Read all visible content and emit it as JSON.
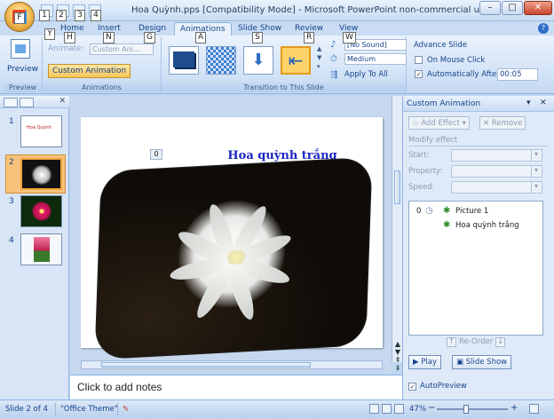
{
  "window": {
    "title": "Hoa Quỳnh.pps [Compatibility Mode] - Microsoft PowerPoint non-commercial use",
    "minimize_glyph": "–",
    "maximize_glyph": "□",
    "close_glyph": "✕"
  },
  "keytips": {
    "office": "F",
    "qat": [
      "1",
      "2",
      "3",
      "4"
    ],
    "ribbon_help": "Y",
    "tabs": [
      "H",
      "N",
      "G",
      "A",
      "S",
      "R",
      "W"
    ]
  },
  "tabs": [
    {
      "label": "Home"
    },
    {
      "label": "Insert"
    },
    {
      "label": "Design"
    },
    {
      "label": "Animations",
      "active": true
    },
    {
      "label": "Slide Show"
    },
    {
      "label": "Review"
    },
    {
      "label": "View"
    }
  ],
  "ribbon": {
    "preview_group": {
      "button": "Preview",
      "label": "Preview"
    },
    "animations_group": {
      "animate_label": "Animate:",
      "animate_value": "Custom Ani...",
      "custom_button": "Custom Animation",
      "label": "Animations"
    },
    "transition_group": {
      "sound_value": "[No Sound]",
      "speed_value": "Medium",
      "apply_all": "Apply To All",
      "label": "Transition to This Slide",
      "advance_title": "Advance Slide",
      "on_mouse_click": "On Mouse Click",
      "auto_after": "Automatically After:",
      "auto_after_value": "00:05",
      "auto_checked": "✓"
    }
  },
  "slides_panel": {
    "slides": [
      {
        "number": "1",
        "title_mini": "Hoa Quỳnh"
      },
      {
        "number": "2"
      },
      {
        "number": "3"
      },
      {
        "number": "4"
      }
    ]
  },
  "slide": {
    "title": "Hoa quỳnh trắng",
    "anim_tag": "0"
  },
  "notes": {
    "placeholder": "Click to add notes"
  },
  "pane": {
    "title": "Custom Animation",
    "add_effect": "Add Effect",
    "remove": "Remove",
    "modify_effect": "Modify effect",
    "start_label": "Start:",
    "property_label": "Property:",
    "speed_label": "Speed:",
    "list": [
      {
        "index": "0",
        "name": "Picture 1"
      },
      {
        "index": "",
        "name": "Hoa quỳnh trắng"
      }
    ],
    "reorder": "Re-Order",
    "play": "Play",
    "slide_show": "Slide Show",
    "autopreview": "AutoPreview",
    "autopreview_checked": "✓"
  },
  "status": {
    "slide_info": "Slide 2 of 4",
    "theme": "\"Office Theme\"",
    "zoom": "47%"
  },
  "colors": {
    "accent": "#15428b",
    "ribbon_bg": "#d1e2f6",
    "title_blue": "#1a28c0",
    "selection": "#f7c27b"
  }
}
